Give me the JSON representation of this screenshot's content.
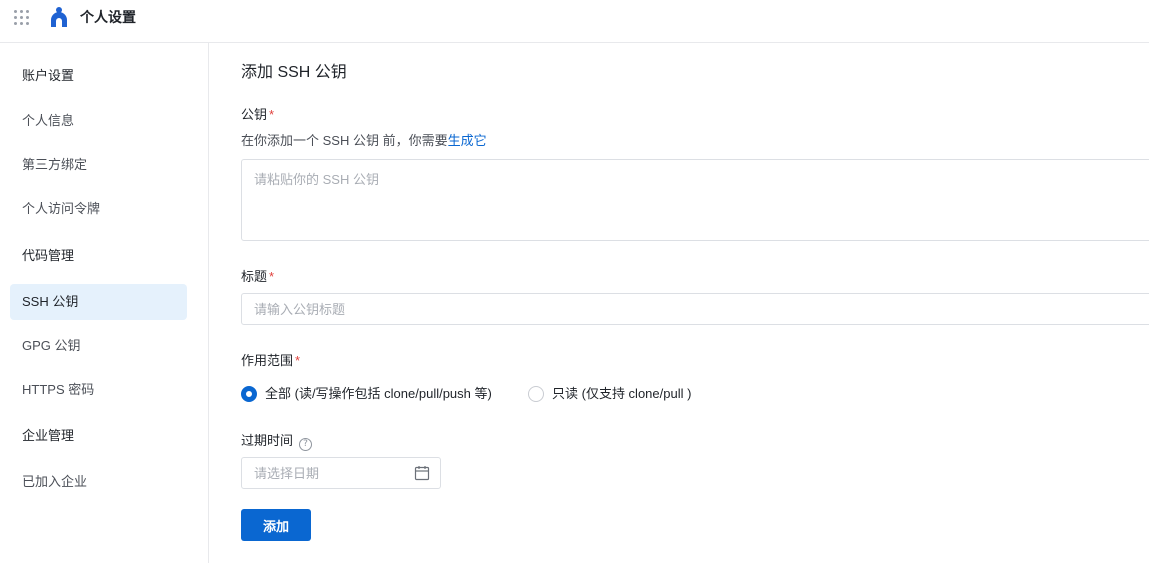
{
  "header": {
    "app_title": "个人设置"
  },
  "sidebar": {
    "items": [
      {
        "label": "账户设置",
        "type": "group"
      },
      {
        "label": "个人信息",
        "type": "item"
      },
      {
        "label": "第三方绑定",
        "type": "item"
      },
      {
        "label": "个人访问令牌",
        "type": "item"
      },
      {
        "label": "代码管理",
        "type": "group"
      },
      {
        "label": "SSH 公钥",
        "type": "item",
        "active": true
      },
      {
        "label": "GPG 公钥",
        "type": "item"
      },
      {
        "label": "HTTPS 密码",
        "type": "item"
      },
      {
        "label": "企业管理",
        "type": "group"
      },
      {
        "label": "已加入企业",
        "type": "item"
      }
    ]
  },
  "form": {
    "title": "添加 SSH 公钥",
    "public_key": {
      "label": "公钥",
      "required_mark": "*",
      "hint_prefix": "在你添加一个 SSH 公钥 前，你需要",
      "hint_link": "生成它",
      "placeholder": "请粘贴你的 SSH 公钥"
    },
    "key_title": {
      "label": "标题",
      "required_mark": "*",
      "placeholder": "请输入公钥标题"
    },
    "scope": {
      "label": "作用范围",
      "required_mark": "*",
      "options": [
        {
          "label": "全部 (读/写操作包括 clone/pull/push 等)",
          "checked": true
        },
        {
          "label": "只读 (仅支持 clone/pull )",
          "checked": false
        }
      ]
    },
    "expiry": {
      "label": "过期时间",
      "help_glyph": "?",
      "placeholder": "请选择日期"
    },
    "submit_label": "添加"
  },
  "colors": {
    "primary": "#0a67d1",
    "active_bg": "#e5f1fc",
    "required": "#e0403c"
  }
}
